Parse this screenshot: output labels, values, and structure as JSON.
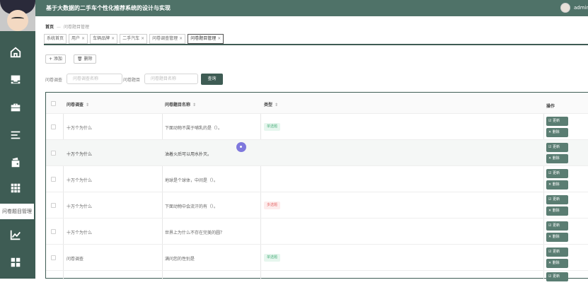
{
  "header": {
    "app_title": "基于大数据的二手车个性化推荐系统的设计与实现",
    "username": "admin"
  },
  "sidebar": {
    "items": [
      {
        "icon": "home-icon"
      },
      {
        "icon": "inbox-icon"
      },
      {
        "icon": "briefcase-icon"
      },
      {
        "icon": "list-icon"
      },
      {
        "icon": "wallet-icon"
      },
      {
        "icon": "grid-icon"
      },
      {
        "icon": "chart-icon"
      },
      {
        "icon": "apps-icon"
      }
    ],
    "tooltip": "问卷题目管理"
  },
  "breadcrumb": {
    "home": "首页",
    "current": "问卷题目管理"
  },
  "tabs": [
    {
      "label": "系统首页",
      "closable": false
    },
    {
      "label": "用户",
      "closable": true
    },
    {
      "label": "车辆品牌",
      "closable": true
    },
    {
      "label": "二手汽车",
      "closable": true
    },
    {
      "label": "问卷调查管理",
      "closable": true
    },
    {
      "label": "问卷题目管理",
      "closable": true,
      "active": true
    }
  ],
  "toolbar": {
    "add_label": "+ 添加",
    "delete_label": "🗑 删除"
  },
  "filters": {
    "survey_label": "问卷调查",
    "survey_placeholder": "问卷调查名称",
    "question_label": "问卷题目",
    "question_placeholder": "问卷题目名称",
    "search_label": "查询"
  },
  "table": {
    "columns": [
      "问卷调查",
      "问卷题目名称",
      "类型",
      "操作"
    ],
    "rows": [
      {
        "survey": "十万个为什么",
        "question": "下面动物不属于哺乳的是（）。",
        "type": "单选题",
        "type_kind": "single"
      },
      {
        "survey": "十万个为什么",
        "question": "油着火后可以用水扑灭。",
        "type": "",
        "type_kind": ""
      },
      {
        "survey": "十万个为什么",
        "question": "地球是个球体，中间是（）。",
        "type": "",
        "type_kind": ""
      },
      {
        "survey": "十万个为什么",
        "question": "下面动物中会流汗的有（）。",
        "type": "多选题",
        "type_kind": "multi"
      },
      {
        "survey": "十万个为什么",
        "question": "世界上为什么不存在完美的圆？",
        "type": "",
        "type_kind": ""
      },
      {
        "survey": "问卷调查",
        "question": "满问您的性别是",
        "type": "单选题",
        "type_kind": "single"
      }
    ],
    "edit_label": "☑ 更新",
    "delete_label": "✕ 删除"
  },
  "colors": {
    "sidebar": "#3e5c54",
    "topbar": "#4f7268",
    "action_button": "#5a7d72",
    "tag_single_text": "#4caf7d",
    "tag_multi_text": "#e46a6a"
  }
}
